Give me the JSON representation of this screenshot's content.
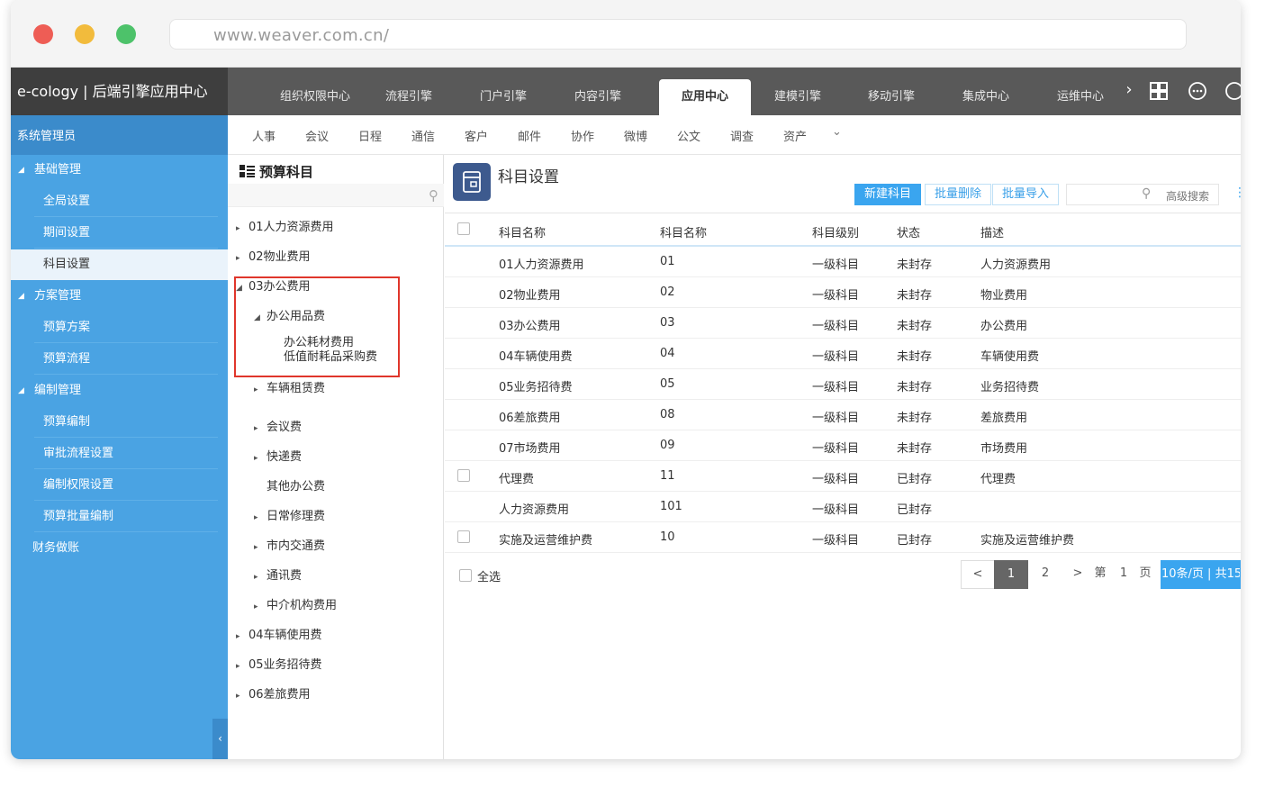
{
  "browser": {
    "url": "www.weaver.com.cn/"
  },
  "app": {
    "brand": "e-cology | 后端引擎应用中心"
  },
  "top_tabs": [
    {
      "label": "组织权限中心"
    },
    {
      "label": "流程引擎"
    },
    {
      "label": "门户引擎"
    },
    {
      "label": "内容引擎"
    },
    {
      "label": "应用中心"
    },
    {
      "label": "建模引擎"
    },
    {
      "label": "移动引擎"
    },
    {
      "label": "集成中心"
    },
    {
      "label": "运维中心"
    }
  ],
  "active_top_tab": "应用中心",
  "sub_nav": [
    "人事",
    "会议",
    "日程",
    "通信",
    "客户",
    "邮件",
    "协作",
    "微博",
    "公文",
    "调查",
    "资产"
  ],
  "sidebar": {
    "header": "系统管理员",
    "groups": [
      {
        "label": "基础管理",
        "items": [
          "全局设置",
          "期间设置",
          "科目设置"
        ]
      },
      {
        "label": "方案管理",
        "items": [
          "预算方案",
          "预算流程"
        ]
      },
      {
        "label": "编制管理",
        "items": [
          "预算编制",
          "审批流程设置",
          "编制权限设置",
          "预算批量编制"
        ]
      }
    ],
    "extra": "财务做账",
    "active_item": "科目设置"
  },
  "tree": {
    "title": "预算科目",
    "nodes": [
      {
        "label": "01人力资源费用",
        "level": 0,
        "arrow": "▸"
      },
      {
        "label": "02物业费用",
        "level": 0,
        "arrow": "▸"
      },
      {
        "label": "03办公费用",
        "level": 0,
        "arrow": "◢"
      },
      {
        "label": "办公用品费",
        "level": 1,
        "arrow": "◢"
      },
      {
        "label": "办公耗材费用",
        "level": 2,
        "arrow": ""
      },
      {
        "label": "低值耐耗品采购费",
        "level": 2,
        "arrow": ""
      },
      {
        "label": "车辆租赁费",
        "level": 1,
        "arrow": "▸"
      },
      {
        "label": "会议费",
        "level": 1,
        "arrow": "▸"
      },
      {
        "label": "快递费",
        "level": 1,
        "arrow": "▸"
      },
      {
        "label": "其他办公费",
        "level": 1,
        "arrow": ""
      },
      {
        "label": "日常修理费",
        "level": 1,
        "arrow": "▸"
      },
      {
        "label": "市内交通费",
        "level": 1,
        "arrow": "▸"
      },
      {
        "label": "通讯费",
        "level": 1,
        "arrow": "▸"
      },
      {
        "label": "中介机构费用",
        "level": 1,
        "arrow": "▸"
      },
      {
        "label": "04车辆使用费",
        "level": 0,
        "arrow": "▸"
      },
      {
        "label": "05业务招待费",
        "level": 0,
        "arrow": "▸"
      },
      {
        "label": "06差旅费用",
        "level": 0,
        "arrow": "▸"
      }
    ]
  },
  "main": {
    "title": "科目设置",
    "buttons": {
      "new": "新建科目",
      "batch_delete": "批量删除",
      "batch_import": "批量导入"
    },
    "search_label": "高级搜索",
    "columns": [
      "科目名称",
      "科目名称",
      "科目级别",
      "状态",
      "描述"
    ],
    "rows": [
      {
        "name": "01人力资源费用",
        "code": "01",
        "level": "一级科目",
        "status": "未封存",
        "desc": "人力资源费用",
        "checkbox": false
      },
      {
        "name": "02物业费用",
        "code": "02",
        "level": "一级科目",
        "status": "未封存",
        "desc": "物业费用",
        "checkbox": false
      },
      {
        "name": "03办公费用",
        "code": "03",
        "level": "一级科目",
        "status": "未封存",
        "desc": "办公费用",
        "checkbox": false
      },
      {
        "name": "04车辆使用费",
        "code": "04",
        "level": "一级科目",
        "status": "未封存",
        "desc": "车辆使用费",
        "checkbox": false
      },
      {
        "name": "05业务招待费",
        "code": "05",
        "level": "一级科目",
        "status": "未封存",
        "desc": "业务招待费",
        "checkbox": false
      },
      {
        "name": "06差旅费用",
        "code": "08",
        "level": "一级科目",
        "status": "未封存",
        "desc": "差旅费用",
        "checkbox": false
      },
      {
        "name": "07市场费用",
        "code": "09",
        "level": "一级科目",
        "status": "未封存",
        "desc": "市场费用",
        "checkbox": false
      },
      {
        "name": "代理费",
        "code": "11",
        "level": "一级科目",
        "status": "已封存",
        "desc": "代理费",
        "checkbox": true
      },
      {
        "name": "人力资源费用",
        "code": "101",
        "level": "一级科目",
        "status": "已封存",
        "desc": "",
        "checkbox": false
      },
      {
        "name": "实施及运营维护费",
        "code": "10",
        "level": "一级科目",
        "status": "已封存",
        "desc": "实施及运营维护费",
        "checkbox": true
      }
    ],
    "select_all": "全选",
    "pager": {
      "prev": "<",
      "pages": [
        "1",
        "2"
      ],
      "current": "1",
      "next": ">",
      "di": "第",
      "page_num": "1",
      "ye": "页",
      "info": "10条/页 | 共15"
    }
  },
  "colors": {
    "sidebar": "#4aa3e3",
    "topbar": "#595959",
    "accent": "#3aa5ef",
    "highlight": "#e0362b"
  }
}
